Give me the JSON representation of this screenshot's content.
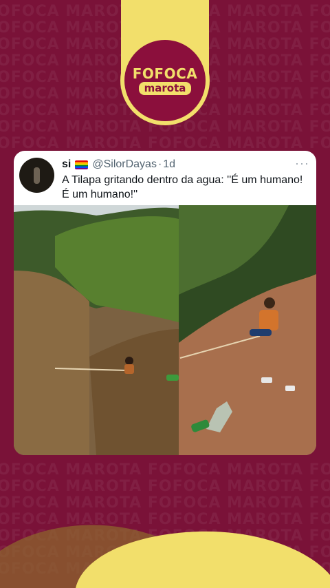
{
  "background": {
    "color": "#7a1238",
    "pattern_text": "FOFOCA MAROTA"
  },
  "logo": {
    "line1": "FOFOCA",
    "line2": "marota",
    "accent": "#f2df6b",
    "base": "#8b0f3c"
  },
  "tweet": {
    "display_name": "si",
    "flag": "rainbow-flag-icon",
    "handle": "@SilorDayas",
    "separator": "·",
    "time": "1d",
    "more": "···",
    "text": "A Tilapa gritando dentro da agua: ''É um humano! É um humano!''"
  }
}
